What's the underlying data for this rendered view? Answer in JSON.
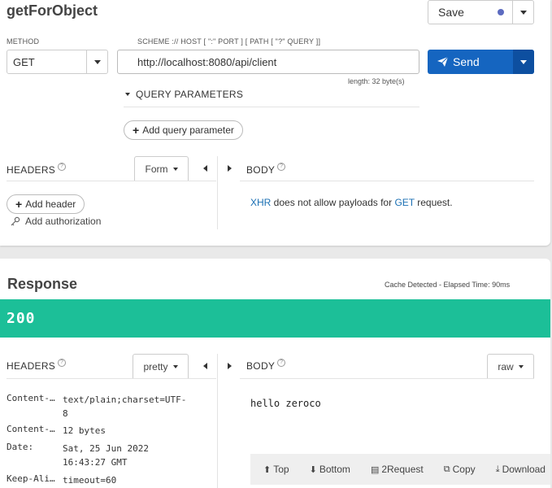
{
  "request": {
    "title": "getForObject",
    "save_label": "Save",
    "method_label": "METHOD",
    "method_value": "GET",
    "scheme_label": "SCHEME :// HOST [ \":\" PORT ] [ PATH [ \"?\" QUERY ]]",
    "url_value": "http://localhost:8080/api/client",
    "length_text": "length: 32 byte(s)",
    "send_label": "Send",
    "query_params_label": "QUERY PARAMETERS",
    "add_query_param_label": "Add query parameter",
    "headers_label": "HEADERS",
    "headers_mode": "Form",
    "add_header_label": "Add header",
    "add_auth_label": "Add authorization",
    "body_label": "BODY",
    "body_msg_pre": "XHR",
    "body_msg_mid": " does not allow payloads for ",
    "body_msg_method": "GET",
    "body_msg_post": " request."
  },
  "response": {
    "title": "Response",
    "cache_text": "Cache Detected - Elapsed Time: 90ms",
    "status_code": "200",
    "status_color": "#1cbf98",
    "headers_label": "HEADERS",
    "headers_mode": "pretty",
    "body_label": "BODY",
    "body_mode": "raw",
    "body_text": "hello zeroco",
    "headers": [
      {
        "key": "Content-Type:",
        "value": "text/plain;charset=UTF-8"
      },
      {
        "key": "Content-Length:",
        "value": "12 bytes"
      },
      {
        "key": "Date:",
        "value": "Sat, 25 Jun 2022 16:43:27 GMT"
      },
      {
        "key": "Keep-Alive:",
        "value": "timeout=60"
      }
    ],
    "toolbar": {
      "top": "Top",
      "bottom": "Bottom",
      "to_request": "2Request",
      "copy": "Copy",
      "download": "Download"
    }
  },
  "colors": {
    "send_button": "#1565c0",
    "send_button_dark": "#0d4fa0",
    "save_dot": "#5c6bc0",
    "link": "#1a6fb3"
  }
}
